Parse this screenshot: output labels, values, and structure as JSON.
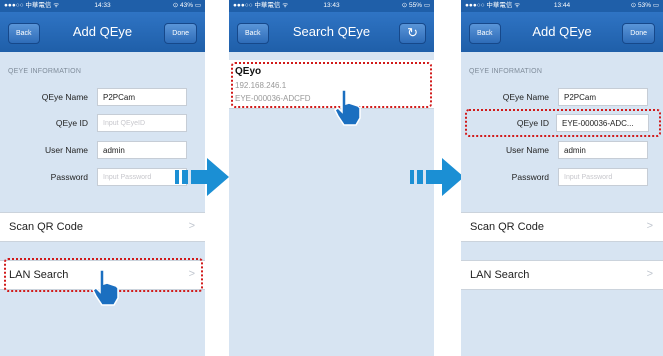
{
  "screens": [
    {
      "status": {
        "carrier": "●●●○○ 中華電信 ᯤ",
        "time": "14:33",
        "battery": "⊙ 43% ▭"
      },
      "nav": {
        "back": "Back",
        "title": "Add QEye",
        "done": "Done"
      },
      "section_header": "QEYE INFORMATION",
      "fields": [
        {
          "label": "QEye Name",
          "value": "P2PCam",
          "placeholder": ""
        },
        {
          "label": "QEye ID",
          "value": "",
          "placeholder": "Input QEyeID"
        },
        {
          "label": "User Name",
          "value": "admin",
          "placeholder": ""
        },
        {
          "label": "Password",
          "value": "",
          "placeholder": "Input Password"
        }
      ],
      "list": [
        {
          "label": "Scan QR Code"
        },
        {
          "label": "LAN Search"
        }
      ]
    },
    {
      "status": {
        "carrier": "●●●○○ 中華電信 ᯤ",
        "time": "13:43",
        "battery": "⊙ 55% ▭"
      },
      "nav": {
        "back": "Back",
        "title": "Search QEye",
        "refresh": "↻"
      },
      "result": {
        "name": "QEyo",
        "ip": "192.168.246.1",
        "id": "EYE-000036-ADCFD"
      }
    },
    {
      "status": {
        "carrier": "●●●○○ 中華電信 ᯤ",
        "time": "13:44",
        "battery": "⊙ 53% ▭"
      },
      "nav": {
        "back": "Back",
        "title": "Add QEye",
        "done": "Done"
      },
      "section_header": "QEYE INFORMATION",
      "fields": [
        {
          "label": "QEye Name",
          "value": "P2PCam",
          "placeholder": ""
        },
        {
          "label": "QEye ID",
          "value": "EYE-000036-ADC...",
          "placeholder": ""
        },
        {
          "label": "User Name",
          "value": "admin",
          "placeholder": ""
        },
        {
          "label": "Password",
          "value": "",
          "placeholder": "Input Password"
        }
      ],
      "list": [
        {
          "label": "Scan QR Code"
        },
        {
          "label": "LAN Search"
        }
      ]
    }
  ],
  "colors": {
    "nav_blue": "#1f5fa9",
    "screen_bg": "#d7e4f2",
    "highlight": "#d11a1a",
    "arrow_blue": "#1b8fd4"
  },
  "icons": [
    "chevron-right-icon",
    "refresh-icon",
    "pointer-hand-icon",
    "step-arrow-icon"
  ]
}
